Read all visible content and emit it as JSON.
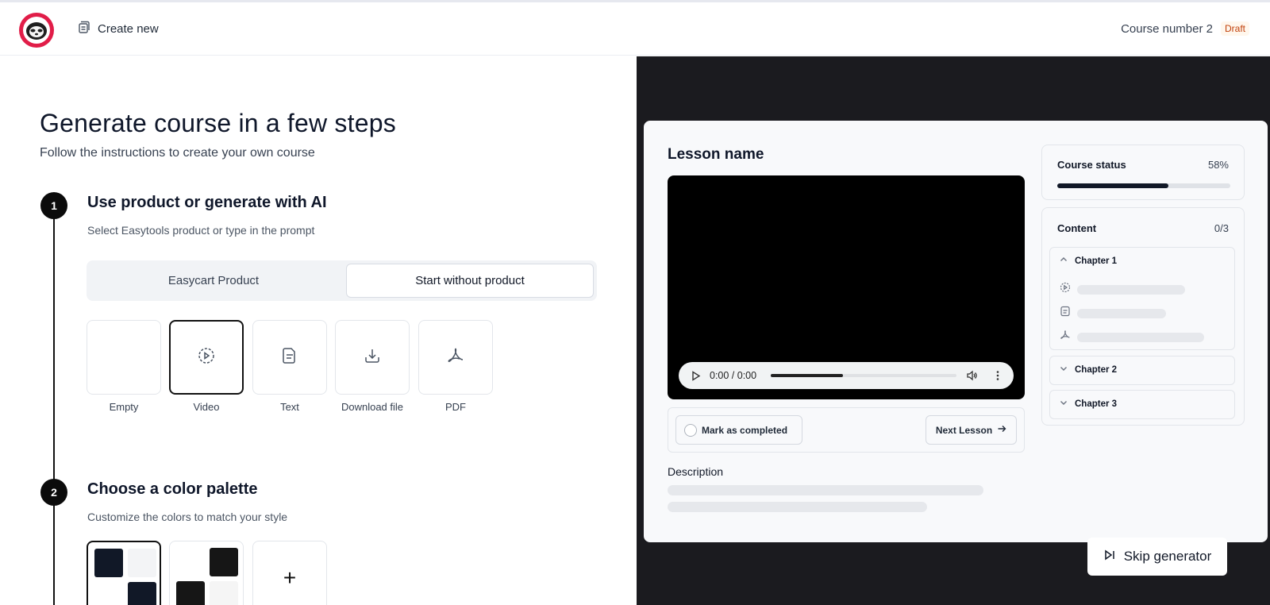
{
  "header": {
    "create_new": "Create new",
    "course_title": "Course number 2",
    "status_badge": "Draft"
  },
  "main": {
    "title": "Generate course in a few steps",
    "subtitle": "Follow the instructions to create your own course"
  },
  "steps": [
    {
      "number": "1",
      "title": "Use product or generate with AI",
      "subtitle": "Select Easytools product or type in the prompt",
      "toggle": [
        "Easycart Product",
        "Start without product"
      ],
      "active_toggle": "Start without product",
      "types": [
        {
          "label": "Empty",
          "icon": "none"
        },
        {
          "label": "Video",
          "icon": "play-circle-icon",
          "selected": true
        },
        {
          "label": "Text",
          "icon": "document-icon"
        },
        {
          "label": "Download file",
          "icon": "download-icon"
        },
        {
          "label": "PDF",
          "icon": "pdf-icon"
        }
      ]
    },
    {
      "number": "2",
      "title": "Choose a color palette",
      "subtitle": "Customize the colors to match your style",
      "add_label": "+"
    }
  ],
  "preview": {
    "lesson_name": "Lesson name",
    "player_time": "0:00 / 0:00",
    "player_progress": 0.39,
    "mark_completed": "Mark as completed",
    "next_lesson": "Next Lesson",
    "description_label": "Description",
    "course_status_label": "Course status",
    "course_status_value": "58%",
    "course_status_progress": 0.64,
    "content_label": "Content",
    "content_count": "0/3",
    "chapters": [
      "Chapter 1",
      "Chapter 2",
      "Chapter 3"
    ]
  },
  "skip_button": "Skip generator",
  "colors": {
    "accent": "#e11d48",
    "dark": "#111827",
    "panel_bg": "#1b1b1f",
    "draft": "#c2410c"
  }
}
